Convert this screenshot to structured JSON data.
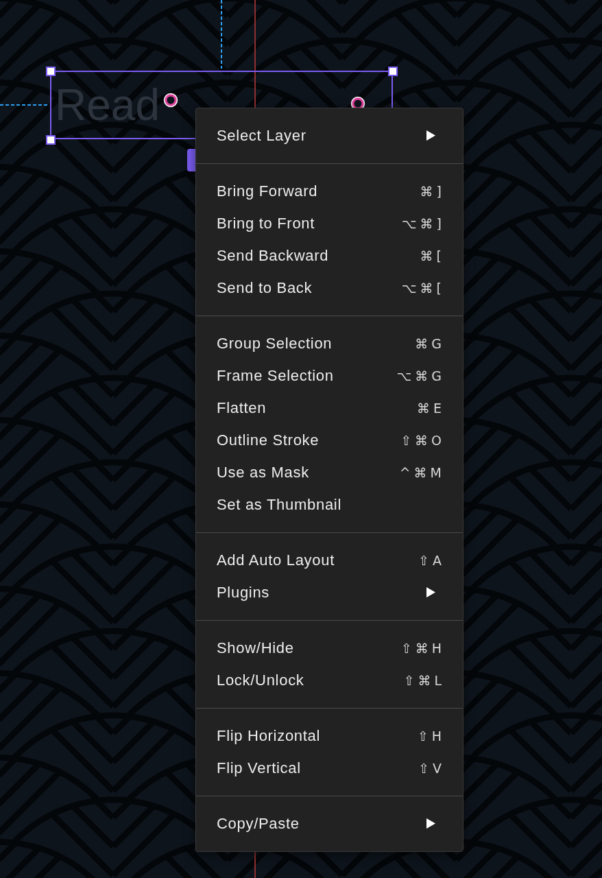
{
  "canvas": {
    "layer_text": "Read"
  },
  "context_menu": {
    "sections": [
      {
        "items": [
          {
            "label": "Select Layer",
            "submenu": true
          }
        ]
      },
      {
        "items": [
          {
            "label": "Bring Forward",
            "shortcut": "⌘]",
            "submenu": false
          },
          {
            "label": "Bring to Front",
            "shortcut": "⌥⌘]",
            "submenu": false
          },
          {
            "label": "Send Backward",
            "shortcut": "⌘[",
            "submenu": false
          },
          {
            "label": "Send to Back",
            "shortcut": "⌥⌘[",
            "submenu": false
          }
        ]
      },
      {
        "items": [
          {
            "label": "Group Selection",
            "shortcut": "⌘G",
            "submenu": false
          },
          {
            "label": "Frame Selection",
            "shortcut": "⌥⌘G",
            "submenu": false
          },
          {
            "label": "Flatten",
            "shortcut": "⌘E",
            "submenu": false
          },
          {
            "label": "Outline Stroke",
            "shortcut": "⇧⌘O",
            "submenu": false
          },
          {
            "label": "Use as Mask",
            "shortcut": "^⌘M",
            "submenu": false
          },
          {
            "label": "Set as Thumbnail",
            "submenu": false
          }
        ]
      },
      {
        "items": [
          {
            "label": "Add Auto Layout",
            "shortcut": "⇧A",
            "submenu": false
          },
          {
            "label": "Plugins",
            "submenu": true
          }
        ]
      },
      {
        "items": [
          {
            "label": "Show/Hide",
            "shortcut": "⇧⌘H",
            "submenu": false
          },
          {
            "label": "Lock/Unlock",
            "shortcut": "⇧⌘L",
            "submenu": false
          }
        ]
      },
      {
        "items": [
          {
            "label": "Flip Horizontal",
            "shortcut": "⇧H",
            "submenu": false
          },
          {
            "label": "Flip Vertical",
            "shortcut": "⇧V",
            "submenu": false
          }
        ]
      },
      {
        "items": [
          {
            "label": "Copy/Paste",
            "submenu": true
          }
        ]
      }
    ]
  }
}
